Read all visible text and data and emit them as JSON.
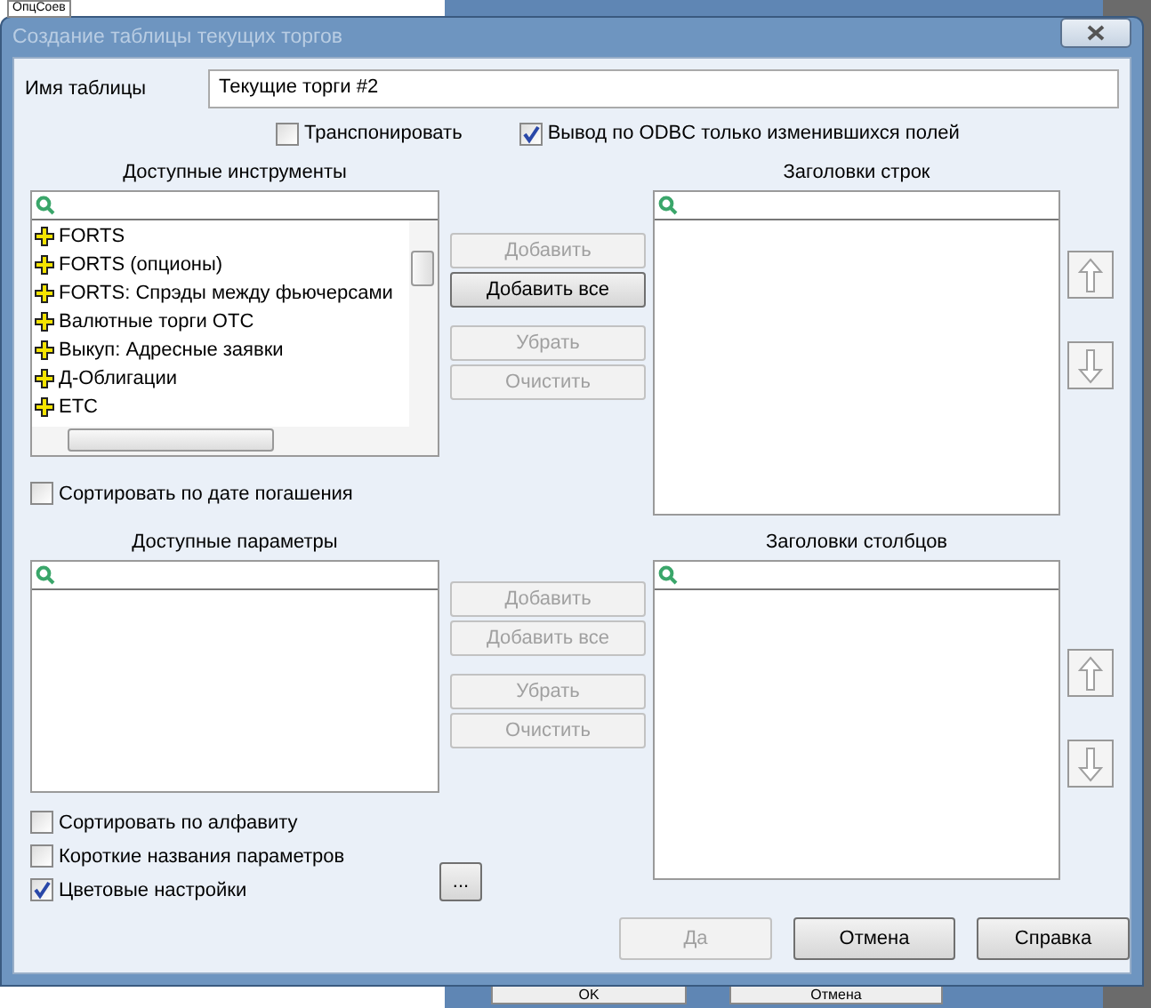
{
  "background": {
    "top_text": "ОпцСоев",
    "buttons": [
      "OK",
      "Отмена"
    ]
  },
  "window": {
    "title": "Создание таблицы текущих торгов"
  },
  "name_field": {
    "label": "Имя таблицы",
    "value": "Текущие торги #2"
  },
  "options": [
    {
      "label": "Транспонировать",
      "checked": false
    },
    {
      "label": "Вывод по ODBC только изменившихся  полей",
      "checked": true
    }
  ],
  "instruments": {
    "title": "Доступные инструменты",
    "items": [
      "FORTS",
      "FORTS (опционы)",
      "FORTS: Спрэды между фьючерсами",
      "Валютные торги OTC",
      "Выкуп: Адресные заявки",
      "Д-Облигации",
      "ETC"
    ],
    "checkboxes": [
      {
        "label": "Сортировать по дате погашения",
        "checked": false
      }
    ]
  },
  "instrument_buttons": [
    {
      "label": "Добавить",
      "disabled": true
    },
    {
      "label": "Добавить все",
      "disabled": false
    },
    {
      "label": "Убрать",
      "disabled": true
    },
    {
      "label": "Очистить",
      "disabled": true
    }
  ],
  "row_headers": {
    "title": "Заголовки строк",
    "arrows": [
      {
        "kind": "up",
        "disabled": true
      },
      {
        "kind": "down",
        "disabled": true
      }
    ]
  },
  "parameters": {
    "title": "Доступные параметры",
    "checkboxes": [
      {
        "label": "Сортировать по алфавиту",
        "checked": false
      },
      {
        "label": "Короткие названия параметров",
        "checked": false
      },
      {
        "label": "Цветовые настройки",
        "checked": true
      }
    ]
  },
  "parameter_buttons": [
    {
      "label": "Добавить",
      "disabled": true
    },
    {
      "label": "Добавить все",
      "disabled": true
    },
    {
      "label": "Убрать",
      "disabled": true
    },
    {
      "label": "Очистить",
      "disabled": true
    }
  ],
  "more_button": {
    "label": "..."
  },
  "column_headers": {
    "title": "Заголовки столбцов",
    "arrows": [
      {
        "kind": "up",
        "disabled": true
      },
      {
        "kind": "down",
        "disabled": true
      }
    ]
  },
  "footer_buttons": [
    {
      "label": "Да",
      "disabled": true
    },
    {
      "label": "Отмена",
      "disabled": false
    },
    {
      "label": "Справка",
      "disabled": false
    }
  ]
}
